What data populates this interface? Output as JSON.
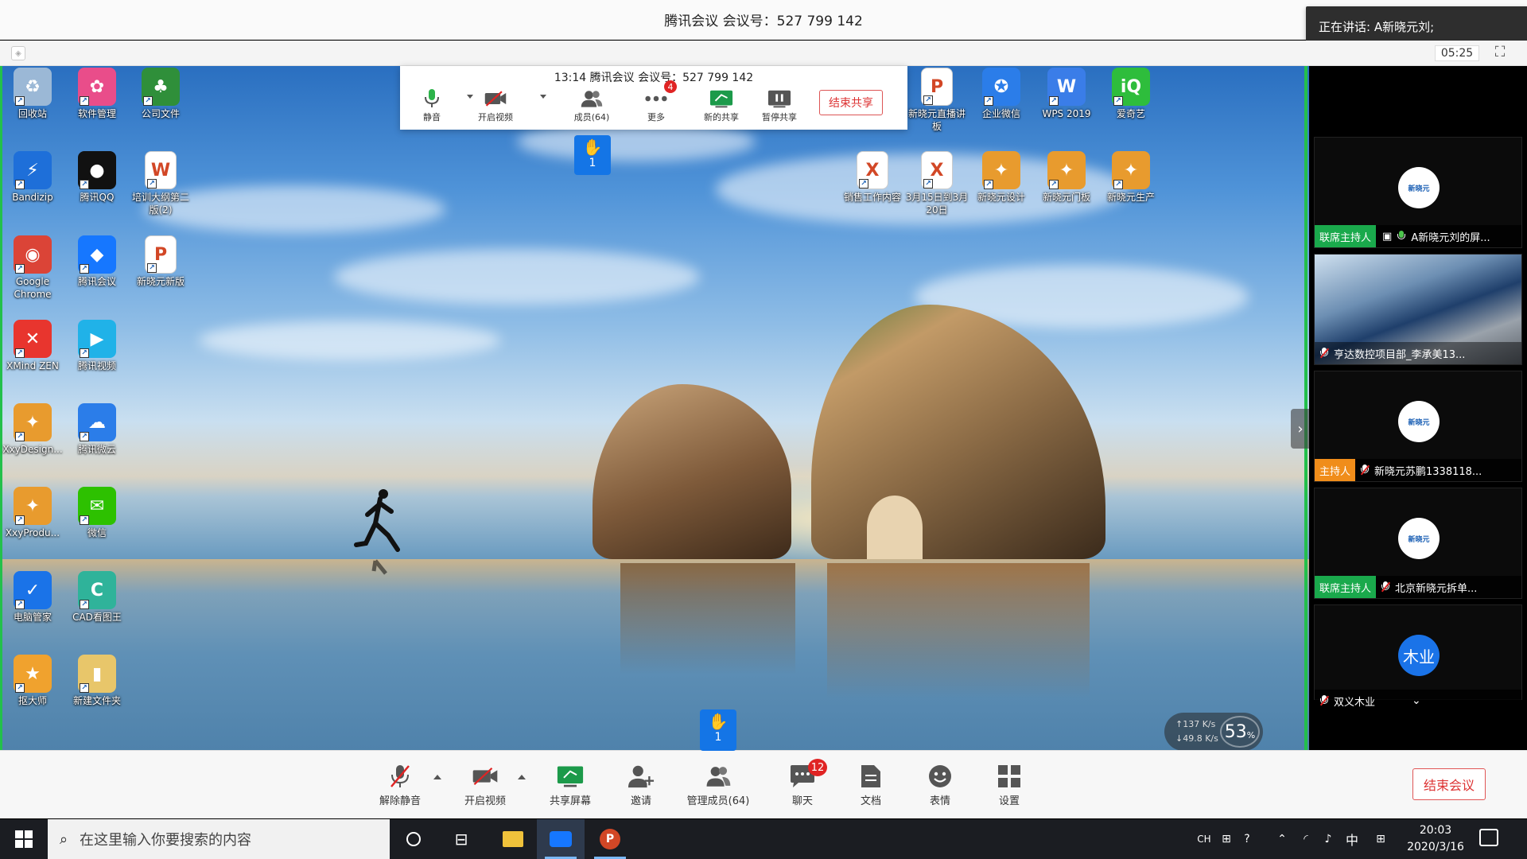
{
  "window": {
    "title": "腾讯会议 会议号：527 799 142",
    "speaking": "正在讲话: A新晓元刘;",
    "timer": "05:25"
  },
  "share_toolbar": {
    "info": "13:14   腾讯会议 会议号：527 799 142",
    "buttons": [
      {
        "label": "静音",
        "icon": "mic-icon"
      },
      {
        "label": "开启视频",
        "icon": "video-off-icon"
      },
      {
        "label": "成员(64)",
        "icon": "members-icon"
      },
      {
        "label": "更多",
        "icon": "more-icon",
        "badge": "4"
      },
      {
        "label": "新的共享",
        "icon": "new-share-icon"
      },
      {
        "label": "暂停共享",
        "icon": "pause-share-icon"
      }
    ],
    "end_share": "结束共享",
    "raise_hand_count": "1"
  },
  "desktop_icons": [
    {
      "label": "回收站",
      "icon": "recycle-bin-icon",
      "color": "#9bb8d6"
    },
    {
      "label": "软件管理",
      "icon": "software-manager-icon",
      "color": "#e94d8a"
    },
    {
      "label": "公司文件",
      "icon": "folder-tree-icon",
      "color": "#2f8f3a"
    },
    {
      "label": "Bandizip",
      "icon": "bandizip-icon",
      "color": "#1e6fd9"
    },
    {
      "label": "腾讯QQ",
      "icon": "qq-icon",
      "color": "#111111"
    },
    {
      "label": "培训大纲第二版(2)",
      "icon": "word-doc-icon",
      "color": "#ffffff"
    },
    {
      "label": "Google Chrome",
      "icon": "chrome-icon",
      "color": "#db4437"
    },
    {
      "label": "腾讯会议",
      "icon": "tencent-meeting-icon",
      "color": "#1677ff"
    },
    {
      "label": "新晓元新版",
      "icon": "ppt-doc-icon",
      "color": "#ffffff"
    },
    {
      "label": "XMind ZEN",
      "icon": "xmind-icon",
      "color": "#e8352e"
    },
    {
      "label": "腾讯视频",
      "icon": "tencent-video-icon",
      "color": "#20b2e8"
    },
    {
      "label": "XxyDesign...",
      "icon": "xxy-design-icon",
      "color": "#e89b2e"
    },
    {
      "label": "腾讯微云",
      "icon": "weiyun-icon",
      "color": "#2b7de9"
    },
    {
      "label": "XxyProdu...",
      "icon": "xxy-product-icon",
      "color": "#e89b2e"
    },
    {
      "label": "微信",
      "icon": "wechat-icon",
      "color": "#2dc100"
    },
    {
      "label": "电脑管家",
      "icon": "pc-manager-icon",
      "color": "#1a73e8"
    },
    {
      "label": "CAD看图王",
      "icon": "cad-viewer-icon",
      "color": "#2fb39a"
    },
    {
      "label": "抠大师",
      "icon": "koudashi-icon",
      "color": "#f0a22e"
    },
    {
      "label": "新建文件夹",
      "icon": "folder-icon",
      "color": "#e8c66a"
    },
    {
      "label": "新晓元直播讲板",
      "icon": "ppt-doc-icon",
      "color": "#ffffff"
    },
    {
      "label": "企业微信",
      "icon": "wecom-icon",
      "color": "#2b7de9"
    },
    {
      "label": "WPS 2019",
      "icon": "wps-icon",
      "color": "#3a7de8"
    },
    {
      "label": "爱奇艺",
      "icon": "iqiyi-icon",
      "color": "#2ebd3c"
    },
    {
      "label": "销售工作内容",
      "icon": "xls-doc-icon",
      "color": "#ffffff"
    },
    {
      "label": "3月15日到3月20日",
      "icon": "xls-doc-icon",
      "color": "#ffffff"
    },
    {
      "label": "新晓元设计",
      "icon": "xxy-app-icon",
      "color": "#e89b2e"
    },
    {
      "label": "新晓元门板",
      "icon": "xxy-app-icon",
      "color": "#e89b2e"
    },
    {
      "label": "新晓元生产",
      "icon": "xxy-app-icon",
      "color": "#e89b2e"
    }
  ],
  "network": {
    "up": "↑137 K/s",
    "down": "↓49.8 K/s",
    "cpu": "53",
    "unit": "%"
  },
  "participants": [
    {
      "role": "联席主持人",
      "name": "A新晓元刘的屏...",
      "avatar": "新晓元",
      "mic": "on",
      "screen": true
    },
    {
      "role": "",
      "name": "亨达数控项目部_李承美13...",
      "avatar": "",
      "mic": "off",
      "camera": true
    },
    {
      "role": "主持人",
      "name": "新晓元苏鹏1338118...",
      "avatar": "新晓元",
      "mic": "off"
    },
    {
      "role": "联席主持人",
      "name": "北京新晓元拆单...",
      "avatar": "新晓元",
      "mic": "off"
    },
    {
      "role": "",
      "name": "双义木业",
      "avatar": "木业",
      "mic": "off"
    }
  ],
  "controls": [
    {
      "label": "解除静音",
      "icon": "mic-muted-icon"
    },
    {
      "label": "开启视频",
      "icon": "video-off-icon"
    },
    {
      "label": "共享屏幕",
      "icon": "share-screen-icon"
    },
    {
      "label": "邀请",
      "icon": "invite-icon"
    },
    {
      "label": "管理成员(64)",
      "icon": "manage-members-icon"
    },
    {
      "label": "聊天",
      "icon": "chat-icon",
      "badge": "12"
    },
    {
      "label": "文档",
      "icon": "document-icon"
    },
    {
      "label": "表情",
      "icon": "emoji-icon"
    },
    {
      "label": "设置",
      "icon": "settings-icon"
    }
  ],
  "end_meeting": "结束会议",
  "taskbar": {
    "search_placeholder": "在这里输入你要搜索的内容",
    "tray_lang": "CH",
    "tray_ime": "中",
    "time": "20:03",
    "date": "2020/3/16"
  },
  "colors": {
    "accent": "#1475e6",
    "active_border": "#23c04b",
    "danger": "#e02424"
  }
}
